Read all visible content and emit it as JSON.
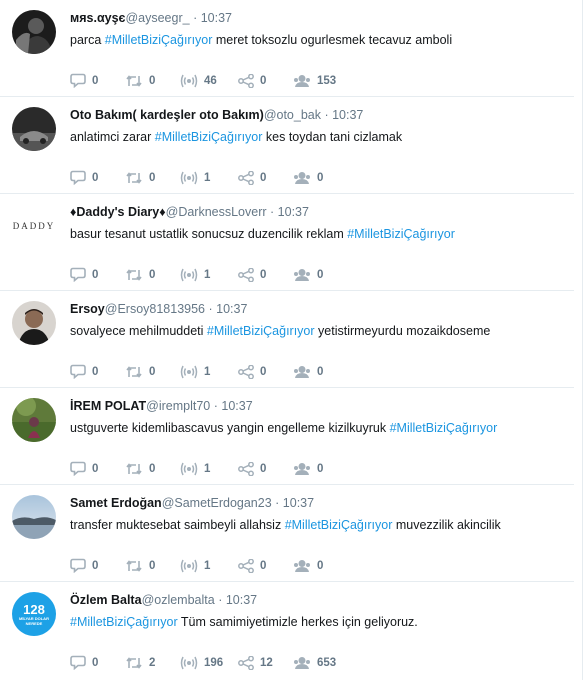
{
  "colors": {
    "hashtag": "#1b95e0",
    "muted": "#657786",
    "text": "#14171a",
    "divider": "#e6ecf0"
  },
  "icons": {
    "reply": "reply-icon",
    "retweet": "retweet-icon",
    "stream": "broadcast-icon",
    "share": "share-icon",
    "users": "users-icon"
  },
  "tweets": [
    {
      "name": "мяѕ.αуşє",
      "handle": "@ayseegr_",
      "time": "· 10:37",
      "text_before": "parca ",
      "hashtag": "#MilletBiziÇağırıyor",
      "text_after": " meret toksozlu ogurlesmek tecavuz amboli",
      "counts": {
        "reply": "0",
        "retweet": "0",
        "stream": "46",
        "share": "0",
        "users": "153"
      }
    },
    {
      "name": "Oto Bakım( kardeşler oto Bakım)",
      "handle": "@oto_bak",
      "time": "· 10:37",
      "text_before": "anlatimci zarar ",
      "hashtag": "#MilletBiziÇağırıyor",
      "text_after": " kes toydan tani cizlamak",
      "counts": {
        "reply": "0",
        "retweet": "0",
        "stream": "1",
        "share": "0",
        "users": "0"
      }
    },
    {
      "name": "♦Daddy's Diary♦",
      "handle": "@DarknessLoverr",
      "time": "· 10:37",
      "avatar_text": "DADDY",
      "text_before": "basur tesanut ustatlik sonucsuz duzencilik reklam ",
      "hashtag": "#MilletBiziÇağırıyor",
      "text_after": "",
      "counts": {
        "reply": "0",
        "retweet": "0",
        "stream": "1",
        "share": "0",
        "users": "0"
      }
    },
    {
      "name": "Ersoy",
      "handle": "@Ersoy81813956",
      "time": "· 10:37",
      "text_before": "sovalyece mehilmuddeti ",
      "hashtag": "#MilletBiziÇağırıyor",
      "text_after": " yetistirmeyurdu mozaikdoseme",
      "counts": {
        "reply": "0",
        "retweet": "0",
        "stream": "1",
        "share": "0",
        "users": "0"
      }
    },
    {
      "name": "İREM POLAT",
      "handle": "@iremplt70",
      "time": "· 10:37",
      "text_before": "ustguverte kidemlibascavus yangin engelleme kizilkuyruk ",
      "hashtag": "#MilletBiziÇağırıyor",
      "text_after": "",
      "counts": {
        "reply": "0",
        "retweet": "0",
        "stream": "1",
        "share": "0",
        "users": "0"
      }
    },
    {
      "name": "Samet Erdoğan",
      "handle": "@SametErdogan23",
      "time": "· 10:37",
      "text_before": "transfer muktesebat saimbeyli allahsiz ",
      "hashtag": "#MilletBiziÇağırıyor",
      "text_after": " muvezzilik akincilik",
      "counts": {
        "reply": "0",
        "retweet": "0",
        "stream": "1",
        "share": "0",
        "users": "0"
      }
    },
    {
      "name": "Özlem Balta",
      "handle": "@ozlembalta",
      "time": "· 10:37",
      "avatar_text": "128",
      "avatar_sub": "MİLYAR DOLAR NEREDE",
      "text_before": "",
      "hashtag": "#MilletBiziÇağırıyor",
      "text_after": " Tüm samimiyetimizle herkes için geliyoruz.",
      "counts": {
        "reply": "0",
        "retweet": "2",
        "stream": "196",
        "share": "12",
        "users": "653"
      }
    }
  ]
}
